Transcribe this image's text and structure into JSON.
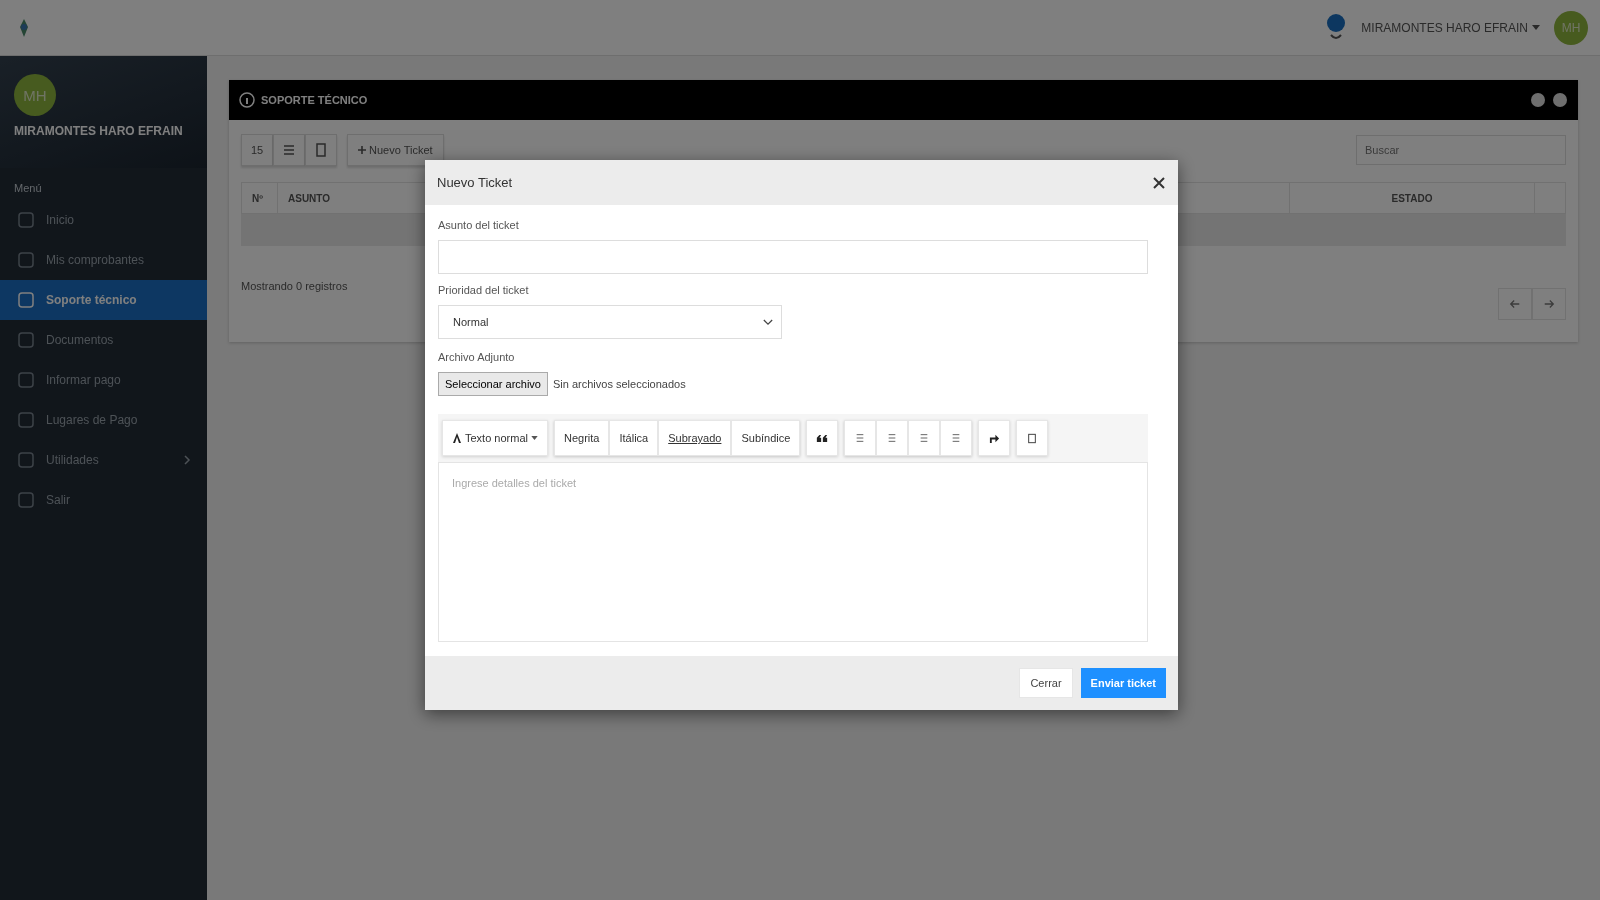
{
  "topbar": {
    "user_name": "MIRAMONTES HARO EFRAIN",
    "avatar_initials": "MH"
  },
  "sidebar": {
    "avatar_initials": "MH",
    "user_name": "MIRAMONTES HARO EFRAIN",
    "section_label": "Menú",
    "items": [
      {
        "label": "Inicio",
        "selected": false,
        "expandable": false
      },
      {
        "label": "Mis comprobantes",
        "selected": false,
        "expandable": false
      },
      {
        "label": "Soporte técnico",
        "selected": true,
        "expandable": false
      },
      {
        "label": "Documentos",
        "selected": false,
        "expandable": false
      },
      {
        "label": "Informar pago",
        "selected": false,
        "expandable": false
      },
      {
        "label": "Lugares de Pago",
        "selected": false,
        "expandable": false
      },
      {
        "label": "Utilidades",
        "selected": false,
        "expandable": true
      },
      {
        "label": "Salir",
        "selected": false,
        "expandable": false
      }
    ]
  },
  "panel": {
    "title": "SOPORTE TÉCNICO",
    "page_size": "15",
    "new_ticket_button": "Nuevo Ticket",
    "search_placeholder": "Buscar",
    "columns": [
      "Nº",
      "ASUNTO",
      "ESTADO"
    ],
    "footer": "Mostrando 0 registros"
  },
  "modal": {
    "title": "Nuevo Ticket",
    "subject_label": "Asunto del ticket",
    "priority_label": "Prioridad del ticket",
    "priority_value": "Normal",
    "attachment_label": "Archivo Adjunto",
    "file_button": "Seleccionar archivo",
    "file_status": "Sin archivos seleccionados",
    "editor": {
      "style_dropdown": "Texto normal",
      "format_buttons": [
        "Negrita",
        "Itálica",
        "Subrayado",
        "Subíndice"
      ],
      "placeholder": "Ingrese detalles del ticket"
    },
    "cancel_button": "Cerrar",
    "submit_button": "Enviar ticket"
  }
}
